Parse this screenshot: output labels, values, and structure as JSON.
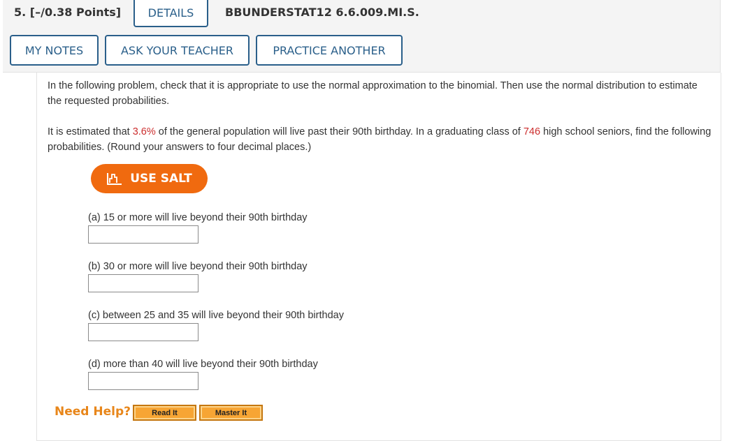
{
  "question": {
    "number_points": "5.  [–/0.38 Points]",
    "details_label": "DETAILS",
    "problem_code": "BBUNDERSTAT12 6.6.009.MI.S."
  },
  "toolbar": {
    "my_notes_label": "MY NOTES",
    "ask_teacher_label": "ASK YOUR TEACHER",
    "practice_another_label": "PRACTICE ANOTHER"
  },
  "problem": {
    "instructions": "In the following problem, check that it is appropriate to use the normal approximation to the binomial. Then use the normal distribution to estimate the requested probabilities.",
    "stem_part1": "It is estimated that ",
    "percent": "3.6%",
    "stem_part2": " of the general population will live past their 90th birthday. In a graduating class of ",
    "class_size": "746",
    "stem_part3": " high school seniors, find the following probabilities. (Round your answers to four decimal places.)"
  },
  "salt": {
    "label": "USE SALT",
    "icon": "salt-chart-icon"
  },
  "parts": [
    {
      "label": "(a) 15 or more will live beyond their 90th birthday",
      "value": ""
    },
    {
      "label": "(b) 30 or more will live beyond their 90th birthday",
      "value": ""
    },
    {
      "label": "(c) between 25 and 35 will live beyond their 90th birthday",
      "value": ""
    },
    {
      "label": "(d) more than 40 will live beyond their 90th birthday",
      "value": ""
    }
  ],
  "help": {
    "need_help_label": "Need Help?",
    "read_it_label": "Read It",
    "master_it_label": "Master It"
  },
  "colors": {
    "accent_blue": "#2a5f8a",
    "highlight_red": "#cc2e2e",
    "salt_orange": "#f06a0f",
    "help_orange": "#e8861a"
  }
}
